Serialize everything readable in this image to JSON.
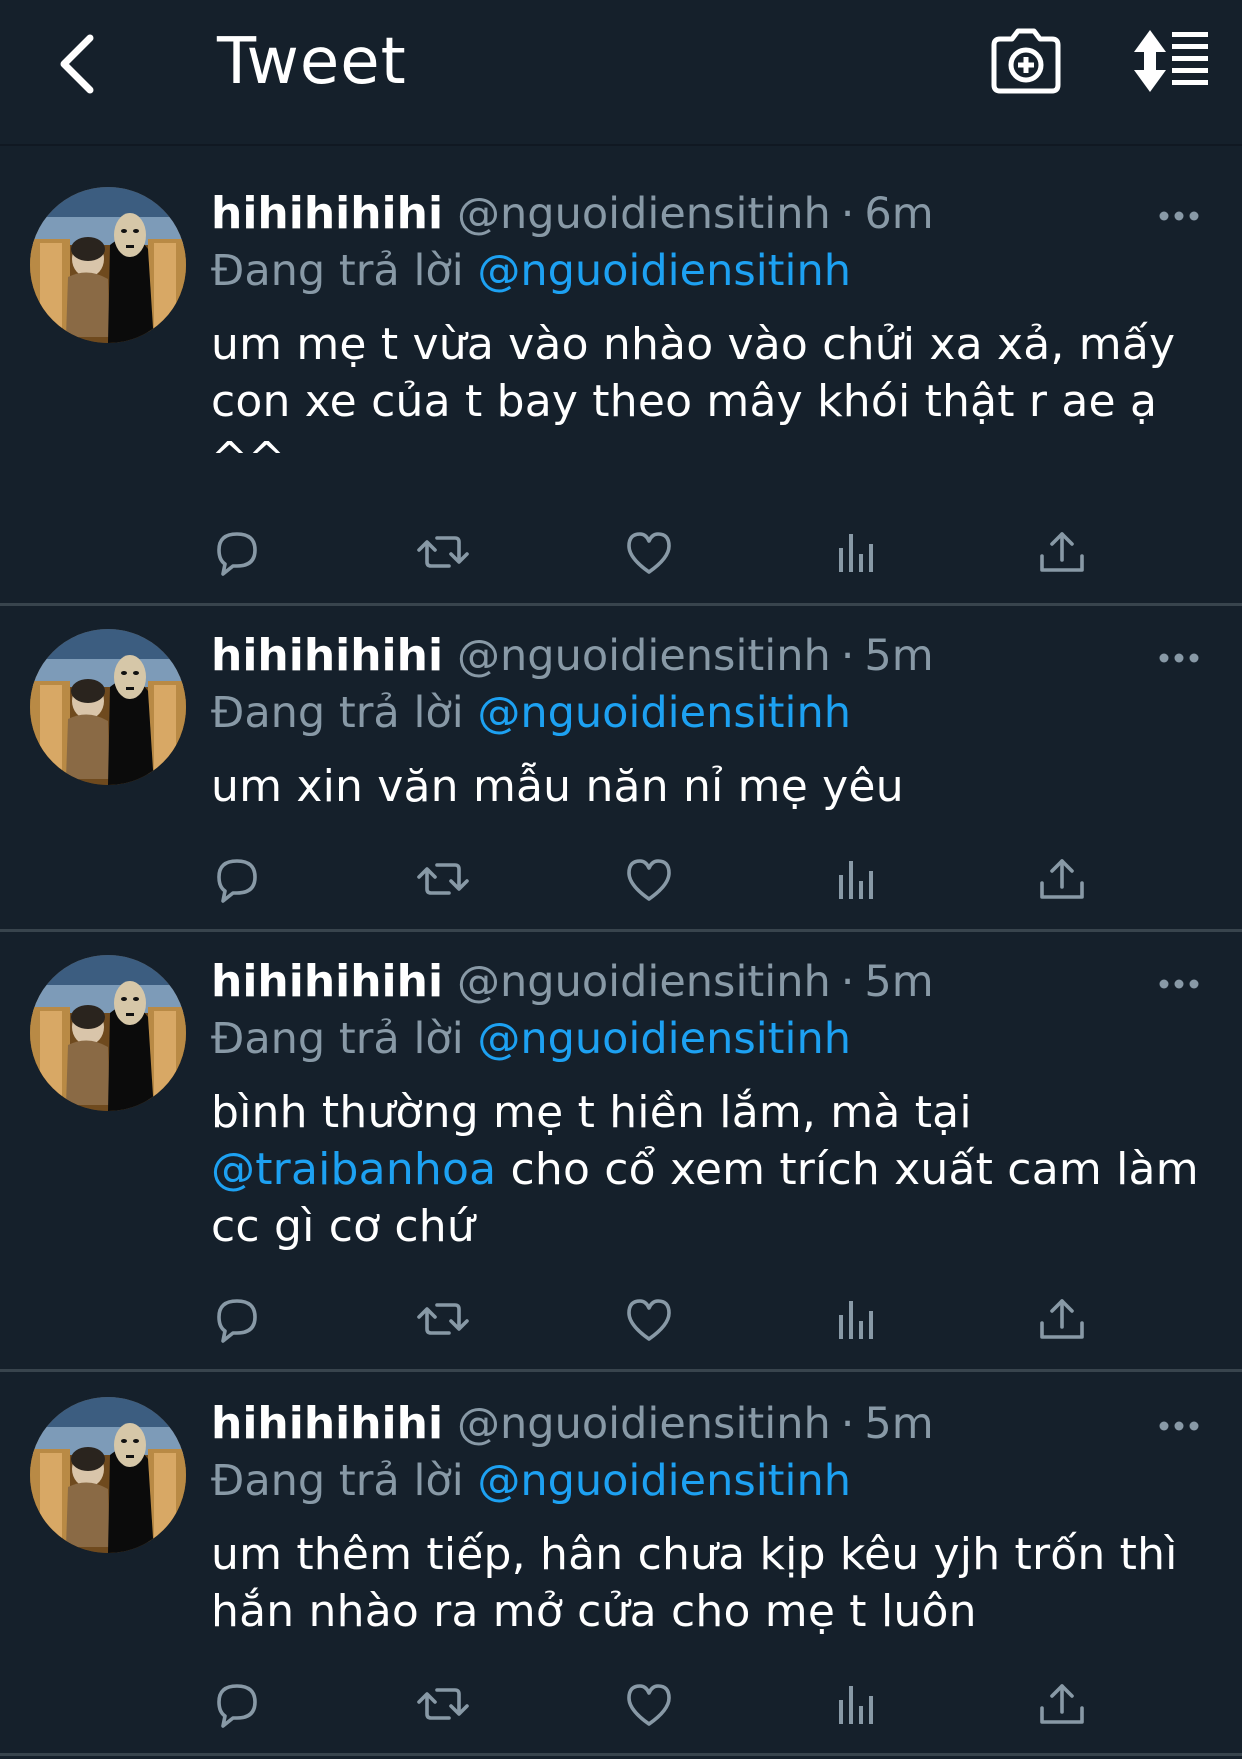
{
  "header": {
    "title": "Tweet"
  },
  "tweets": [
    {
      "display_name": "hihihihihi",
      "handle": "@nguoidiensitinh",
      "separator": "·",
      "time": "6m",
      "reply_label": "Đang trả lời",
      "reply_to": "@nguoidiensitinh",
      "text_lines": [
        "um mẹ t vừa vào nhào vào chửi xa xả, mấy",
        "con xe của t bay theo mây khói thật r ae ạ",
        "^^"
      ]
    },
    {
      "display_name": "hihihihihi",
      "handle": "@nguoidiensitinh",
      "separator": "·",
      "time": "5m",
      "reply_label": "Đang trả lời",
      "reply_to": "@nguoidiensitinh",
      "text_lines": [
        "um xin văn mẫu năn nỉ mẹ yêu"
      ]
    },
    {
      "display_name": "hihihihihi",
      "handle": "@nguoidiensitinh",
      "separator": "·",
      "time": "5m",
      "reply_label": "Đang trả lời",
      "reply_to": "@nguoidiensitinh",
      "text_line1": "bình thường mẹ t hiền lắm, mà tại",
      "mention": "@traibanhoa",
      "text_line2_rest": " cho cổ xem trích xuất cam làm",
      "text_line3": "cc gì cơ chứ"
    },
    {
      "display_name": "hihihihihi",
      "handle": "@nguoidiensitinh",
      "separator": "·",
      "time": "5m",
      "reply_label": "Đang trả lời",
      "reply_to": "@nguoidiensitinh",
      "text_lines": [
        "um thêm tiếp, hân chưa kịp kêu yjh trốn thì",
        "hắn nhào ra mở cửa cho mẹ t luôn"
      ]
    }
  ],
  "colors": {
    "background": "#15202b",
    "accent": "#1da1f2",
    "secondary_text": "#8899a6",
    "divider": "#38444d"
  },
  "icons": [
    "back-chevron-icon",
    "camera-plus-icon",
    "sort-icon",
    "reply-icon",
    "retweet-icon",
    "like-icon",
    "analytics-icon",
    "share-icon",
    "more-icon"
  ]
}
